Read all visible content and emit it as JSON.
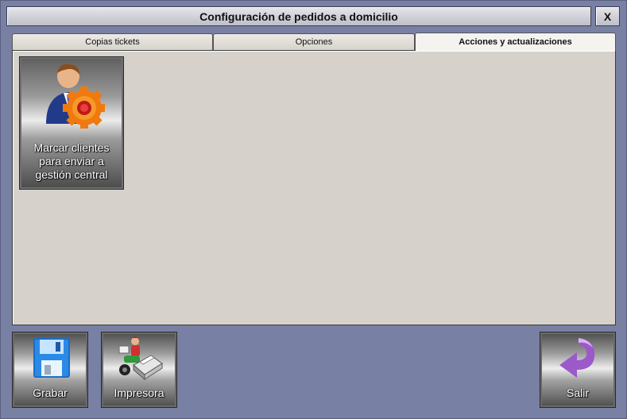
{
  "window": {
    "title": "Configuración de pedidos a domicilio",
    "close_label": "X"
  },
  "tabs": [
    {
      "label": "Copias tickets",
      "active": false
    },
    {
      "label": "Opciones",
      "active": false
    },
    {
      "label": "Acciones y actualizaciones",
      "active": true
    }
  ],
  "actions": [
    {
      "label": "Marcar clientes\npara enviar a\ngestión central",
      "icon": "user-gear-icon"
    }
  ],
  "footer": {
    "save_label": "Grabar",
    "save_icon": "floppy-disk-icon",
    "printer_label": "Impresora",
    "printer_icon": "delivery-printer-icon",
    "exit_label": "Salir",
    "exit_icon": "return-arrow-icon"
  },
  "colors": {
    "background": "#7880a3",
    "panel": "#d6d2cb",
    "arrow": "#9b59c9"
  }
}
